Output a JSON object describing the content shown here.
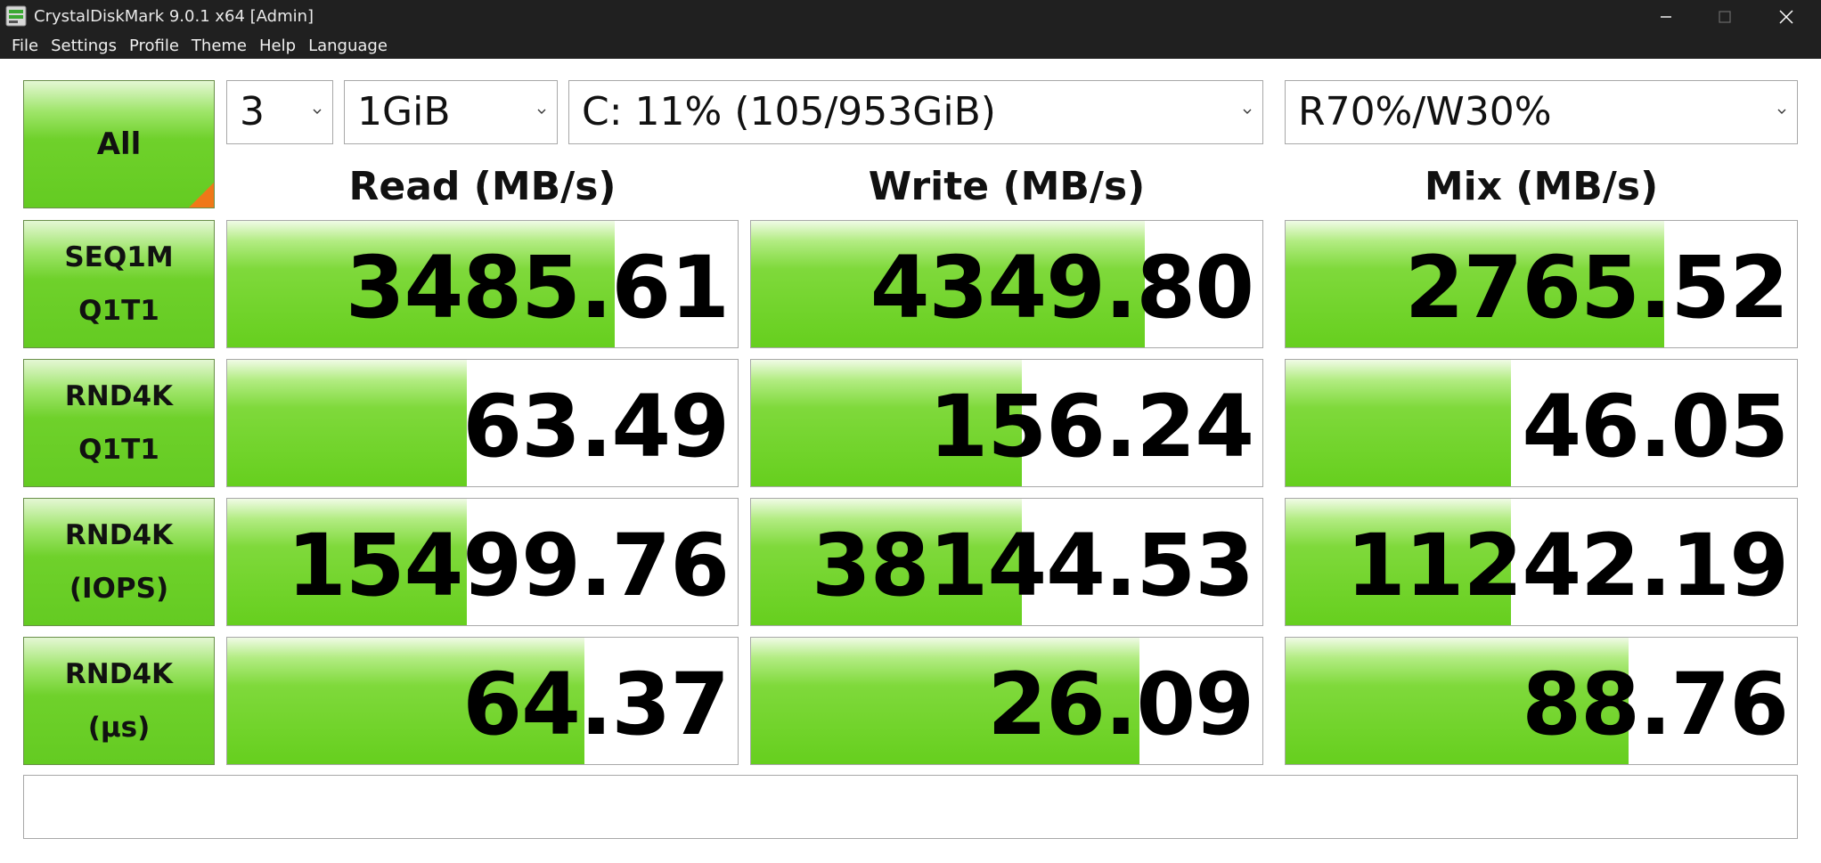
{
  "window": {
    "title": "CrystalDiskMark 9.0.1 x64 [Admin]"
  },
  "menu": [
    "File",
    "Settings",
    "Profile",
    "Theme",
    "Help",
    "Language"
  ],
  "toolbar": {
    "all_label": "All",
    "count": "3",
    "size": "1GiB",
    "drive": "C: 11% (105/953GiB)",
    "mix_ratio": "R70%/W30%"
  },
  "headers": [
    "Read (MB/s)",
    "Write (MB/s)",
    "Mix (MB/s)"
  ],
  "rows": [
    {
      "label1": "SEQ1M",
      "label2": "Q1T1",
      "cells": [
        {
          "value": "3485.61",
          "fill": 0.76
        },
        {
          "value": "4349.80",
          "fill": 0.77
        },
        {
          "value": "2765.52",
          "fill": 0.74
        }
      ]
    },
    {
      "label1": "RND4K",
      "label2": "Q1T1",
      "cells": [
        {
          "value": "63.49",
          "fill": 0.47
        },
        {
          "value": "156.24",
          "fill": 0.53
        },
        {
          "value": "46.05",
          "fill": 0.44
        }
      ]
    },
    {
      "label1": "RND4K",
      "label2": "(IOPS)",
      "cells": [
        {
          "value": "15499.76",
          "fill": 0.47
        },
        {
          "value": "38144.53",
          "fill": 0.53
        },
        {
          "value": "11242.19",
          "fill": 0.44
        }
      ]
    },
    {
      "label1": "RND4K",
      "label2": "(µs)",
      "cells": [
        {
          "value": "64.37",
          "fill": 0.7
        },
        {
          "value": "26.09",
          "fill": 0.76
        },
        {
          "value": "88.76",
          "fill": 0.67
        }
      ]
    }
  ],
  "comment": "",
  "colors": {
    "bar_green": "#66cf1e",
    "corner_orange": "#f07818",
    "titlebar": "#202020"
  }
}
